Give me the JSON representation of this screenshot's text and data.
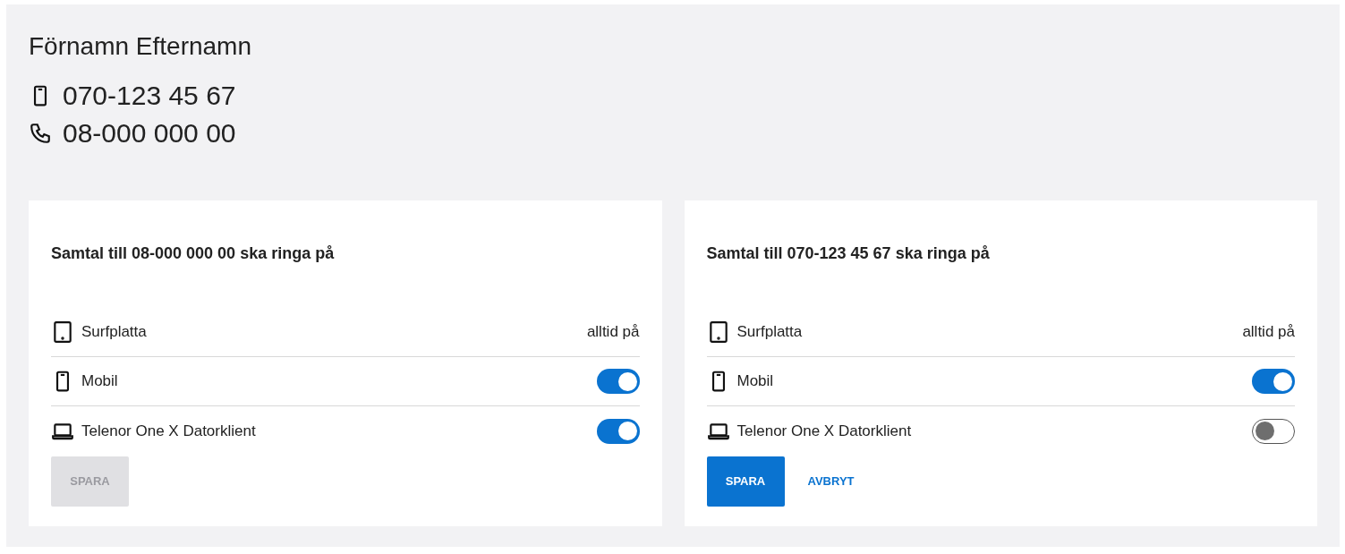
{
  "name": "Förnamn Efternamn",
  "numbers": [
    {
      "kind": "mobile",
      "number": "070-123 45 67"
    },
    {
      "kind": "landline",
      "number": "08-000 000 00"
    }
  ],
  "cards": [
    {
      "title": "Samtal till 08-000 000 00 ska ringa på",
      "devices": [
        {
          "kind": "tablet",
          "label": "Surfplatta",
          "status": "alltid på"
        },
        {
          "kind": "mobile",
          "label": "Mobil",
          "on": true
        },
        {
          "kind": "laptop",
          "label": "Telenor One X Datorklient",
          "on": true
        }
      ],
      "save": {
        "label": "SPARA",
        "disabled": true
      }
    },
    {
      "title": "Samtal till 070-123 45 67 ska ringa på",
      "devices": [
        {
          "kind": "tablet",
          "label": "Surfplatta",
          "status": "alltid på"
        },
        {
          "kind": "mobile",
          "label": "Mobil",
          "on": true
        },
        {
          "kind": "laptop",
          "label": "Telenor One X Datorklient",
          "on": false
        }
      ],
      "save": {
        "label": "SPARA",
        "disabled": false
      },
      "cancel": "AVBRYT"
    }
  ]
}
